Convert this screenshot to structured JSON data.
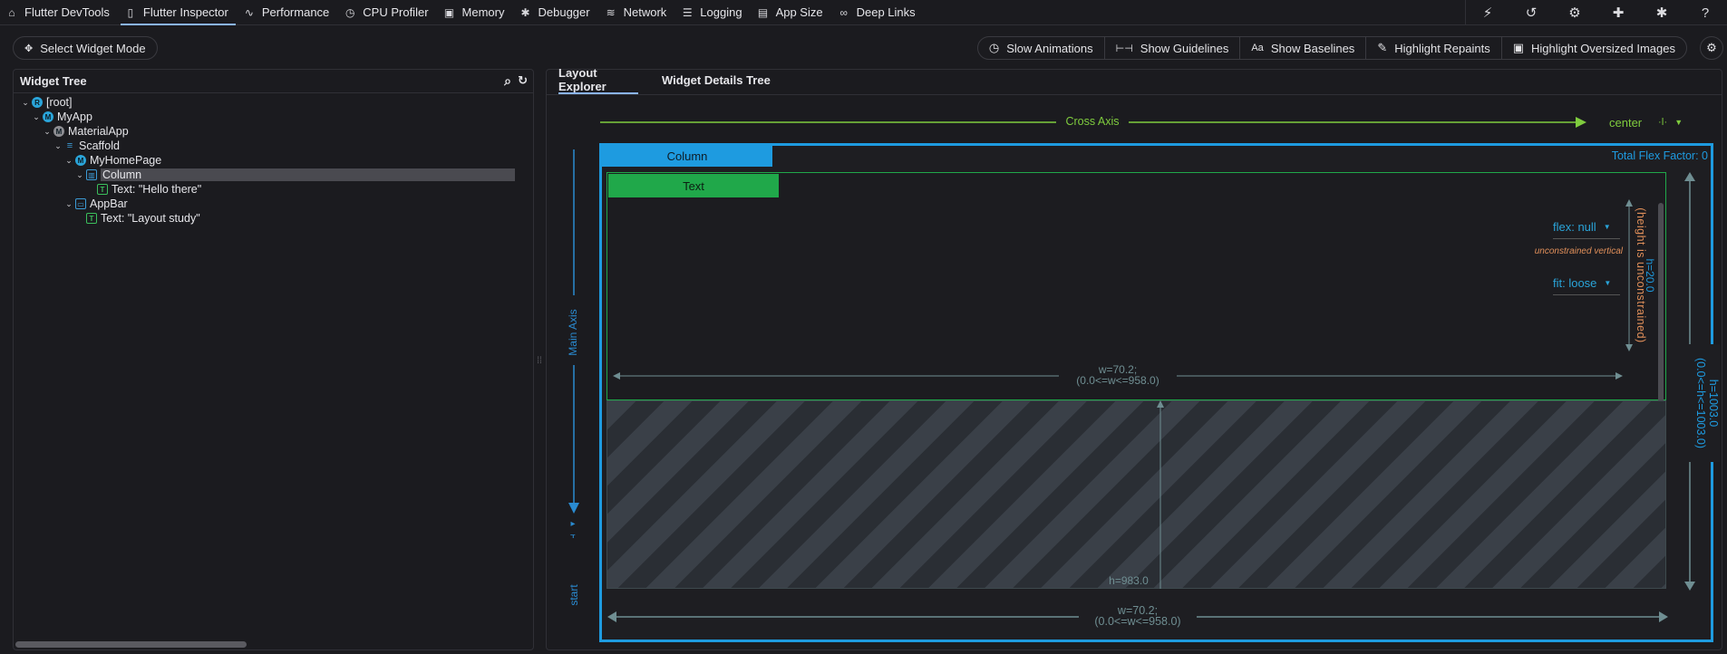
{
  "topnav": {
    "tabs": [
      {
        "label": "Flutter DevTools",
        "icon": "home-icon",
        "glyph": "⌂"
      },
      {
        "label": "Flutter Inspector",
        "icon": "inspector-icon",
        "glyph": "▯"
      },
      {
        "label": "Performance",
        "icon": "performance-icon",
        "glyph": "∿"
      },
      {
        "label": "CPU Profiler",
        "icon": "timer-icon",
        "glyph": "◷"
      },
      {
        "label": "Memory",
        "icon": "memory-icon",
        "glyph": "▣"
      },
      {
        "label": "Debugger",
        "icon": "bug-icon",
        "glyph": "✱"
      },
      {
        "label": "Network",
        "icon": "wifi-icon",
        "glyph": "≋"
      },
      {
        "label": "Logging",
        "icon": "logging-icon",
        "glyph": "☰"
      },
      {
        "label": "App Size",
        "icon": "file-icon",
        "glyph": "▤"
      },
      {
        "label": "Deep Links",
        "icon": "link-icon",
        "glyph": "∞"
      }
    ],
    "active_tab": "Flutter Inspector",
    "right_icons": [
      {
        "name": "bolt-icon",
        "glyph": "⚡"
      },
      {
        "name": "history-icon",
        "glyph": "↺"
      },
      {
        "name": "settings-icon",
        "glyph": "⚙"
      },
      {
        "name": "extension-icon",
        "glyph": "✚"
      },
      {
        "name": "bug-report-icon",
        "glyph": "✱"
      },
      {
        "name": "help-icon",
        "glyph": "?"
      }
    ]
  },
  "toolbar": {
    "select_widget_mode": "Select Widget Mode",
    "slow_animations": "Slow Animations",
    "show_guidelines": "Show Guidelines",
    "show_baselines": "Show Baselines",
    "highlight_repaints": "Highlight Repaints",
    "highlight_oversized": "Highlight Oversized Images"
  },
  "widget_tree": {
    "title": "Widget Tree",
    "nodes": [
      {
        "label": "[root]",
        "icon_letter": "R"
      },
      {
        "label": "MyApp",
        "icon_letter": "M"
      },
      {
        "label": "MaterialApp",
        "icon_letter": "M"
      },
      {
        "label": "Scaffold",
        "icon_letter": "≡"
      },
      {
        "label": "MyHomePage",
        "icon_letter": "M"
      },
      {
        "label": "Column",
        "icon_letter": "▥"
      },
      {
        "label": "Text: \"Hello there\"",
        "icon_letter": "T"
      },
      {
        "label": "AppBar",
        "icon_letter": "▭"
      },
      {
        "label": "Text: \"Layout study\"",
        "icon_letter": "T"
      }
    ],
    "selected": "Column"
  },
  "layout_explorer": {
    "tabs": [
      "Layout Explorer",
      "Widget Details Tree"
    ],
    "active_tab": "Layout Explorer",
    "cross_axis_label": "Cross Axis",
    "cross_axis_value": "center",
    "main_axis_label": "Main Axis",
    "main_axis_value": "start",
    "column_label": "Column",
    "total_flex": "Total Flex Factor: 0",
    "child_label": "Text",
    "flex_label": "flex: null",
    "unconstrained_note": "unconstrained vertical",
    "fit_label": "fit: loose",
    "child_height": "h=20.0",
    "height_unconstrained": "(height is unconstrained)",
    "inner_width": "w=70.2;",
    "inner_width_constraint": "(0.0<=w<=958.0)",
    "free_space_height": "h=983.0",
    "outer_height": "h=1003.0",
    "outer_height_constraint": "(0.0<=h<=1003.0)",
    "outer_width": "w=70.2;",
    "outer_width_constraint": "(0.0<=w<=958.0)",
    "colors": {
      "accent_blue": "#1e9be0",
      "green": "#20a84a",
      "axis_green": "#7fcc3e",
      "measure": "#6f8e92"
    }
  }
}
